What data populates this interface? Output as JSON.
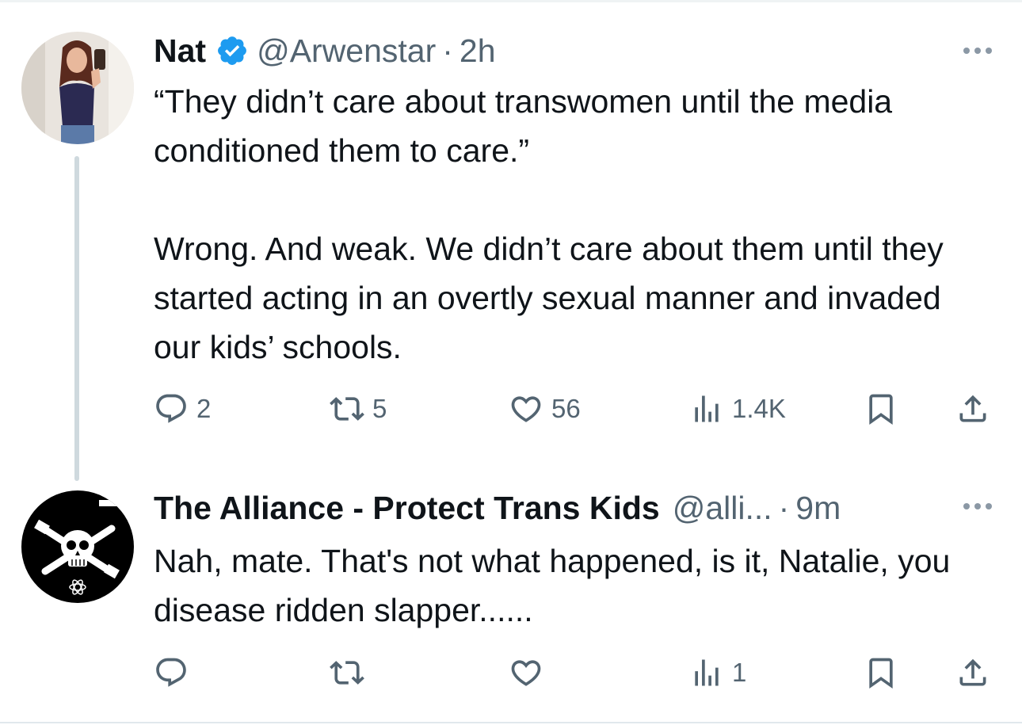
{
  "tweets": [
    {
      "name": "Nat",
      "verified": true,
      "handle": "@Arwenstar",
      "separator": "·",
      "time": "2h",
      "text": [
        "“They didn’t care about transwomen until the media conditioned them to care.”",
        "Wrong. And weak. We didn’t care about them until they started acting in an overtly sexual manner and invaded our kids’ schools."
      ],
      "stats": {
        "replies": "2",
        "retweets": "5",
        "likes": "56",
        "views": "1.4K"
      }
    },
    {
      "name": "The Alliance - Protect Trans Kids",
      "verified": false,
      "handle": "@alli...",
      "separator": "·",
      "time": "9m",
      "text": [
        "Nah, mate.  That's not what happened, is it, Natalie, you disease ridden slapper......"
      ],
      "stats": {
        "replies": "",
        "retweets": "",
        "likes": "",
        "views": "1"
      }
    }
  ],
  "icons": {
    "verified": "verified-badge-icon",
    "more": "more-options-icon",
    "reply": "reply-icon",
    "retweet": "retweet-icon",
    "like": "heart-icon",
    "views": "views-chart-icon",
    "bookmark": "bookmark-icon",
    "share": "share-icon"
  },
  "colors": {
    "text": "#0f1419",
    "secondary": "#536471",
    "verified_blue": "#1d9bf0",
    "thread_line": "#cfd9de"
  }
}
